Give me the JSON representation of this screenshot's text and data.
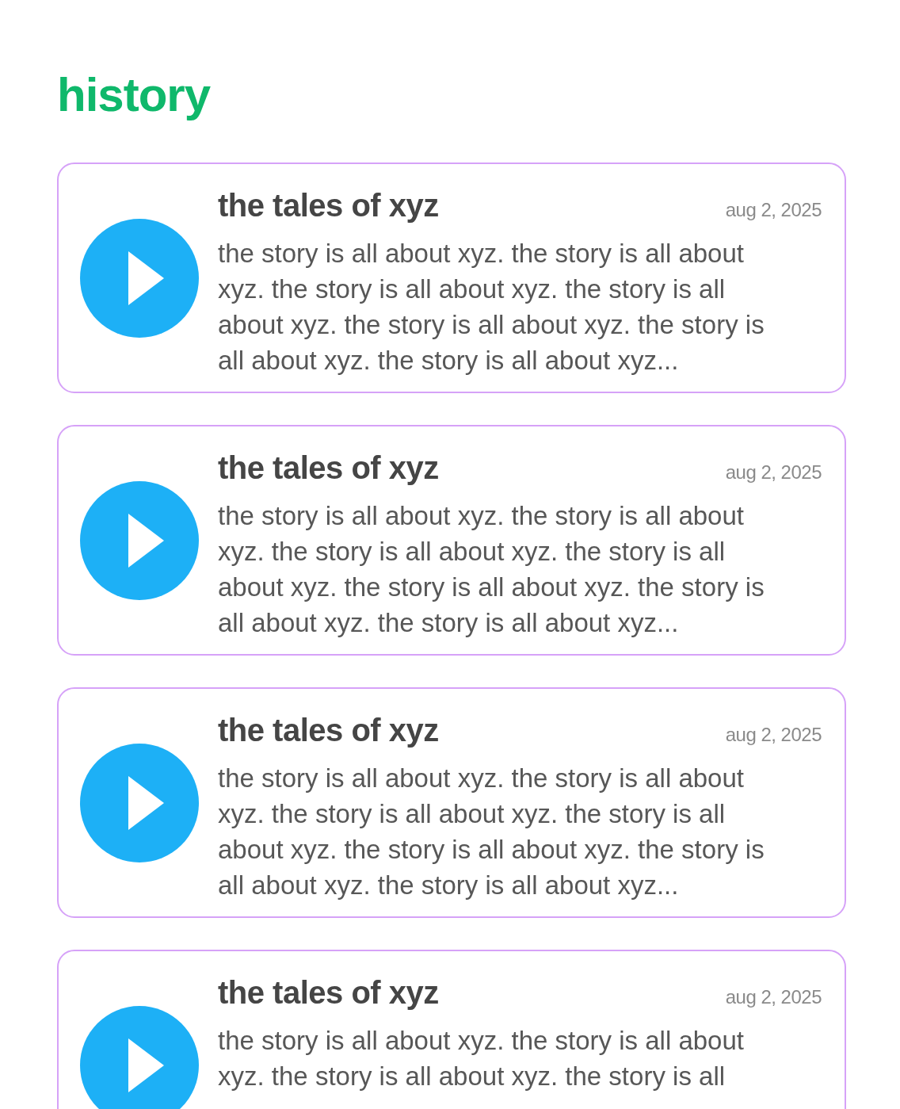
{
  "page": {
    "title": "history"
  },
  "items": [
    {
      "title": "the tales of xyz",
      "date": "aug 2, 2025",
      "description": "the story is all about xyz. the story is all about xyz. the story is all about xyz. the story is all about xyz. the story is all about xyz. the story is all about xyz. the story is all about xyz..."
    },
    {
      "title": "the tales of xyz",
      "date": "aug 2, 2025",
      "description": "the story is all about xyz. the story is all about xyz. the story is all about xyz. the story is all about xyz. the story is all about xyz. the story is all about xyz. the story is all about xyz..."
    },
    {
      "title": "the tales of xyz",
      "date": "aug 2, 2025",
      "description": "the story is all about xyz. the story is all about xyz. the story is all about xyz. the story is all about xyz. the story is all about xyz. the story is all about xyz. the story is all about xyz..."
    },
    {
      "title": "the tales of xyz",
      "date": "aug 2, 2025",
      "description": "the story is all about xyz. the story is all about xyz. the story is all about xyz. the story is all"
    }
  ]
}
